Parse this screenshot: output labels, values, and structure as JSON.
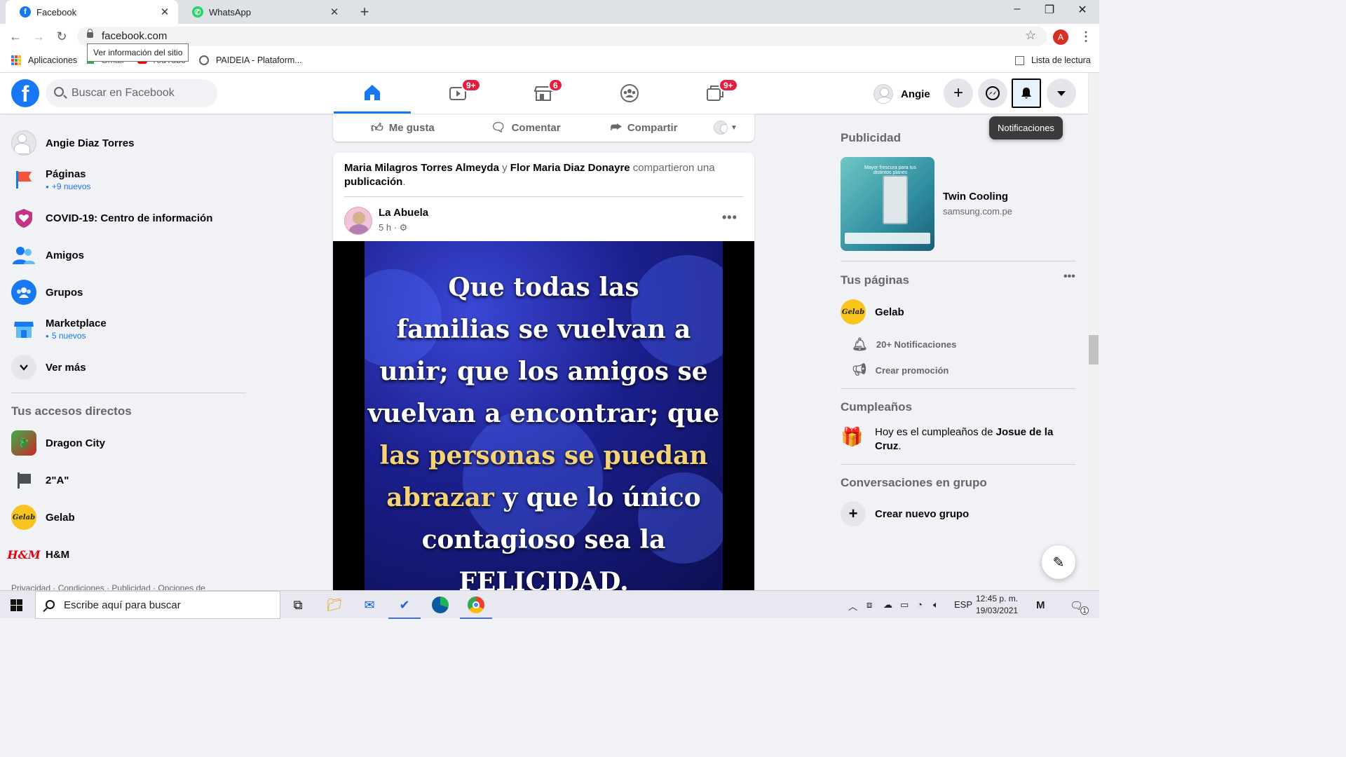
{
  "browser": {
    "tabs": [
      {
        "title": "Facebook",
        "active": true
      },
      {
        "title": "WhatsApp",
        "active": false
      }
    ],
    "new_tab": "+",
    "close_glyph": "✕",
    "url": "facebook.com",
    "site_info_tooltip": "Ver información del sitio",
    "profile_initial": "A",
    "bookmarks": {
      "apps": "Aplicaciones",
      "gmail": "Gmail",
      "youtube": "YouTube",
      "paideia": "PAIDEIA - Plataform...",
      "reading_list": "Lista de lectura"
    }
  },
  "fb": {
    "search_placeholder": "Buscar en Facebook",
    "nav_badges": {
      "watch": "9+",
      "marketplace": "6",
      "gaming": "9+"
    },
    "user_name": "Angie",
    "notifications_tooltip": "Notificaciones"
  },
  "left": {
    "items": [
      {
        "label": "Angie Diaz Torres"
      },
      {
        "label": "Páginas",
        "sub": "+9 nuevos"
      },
      {
        "label": "COVID-19: Centro de información"
      },
      {
        "label": "Amigos"
      },
      {
        "label": "Grupos"
      },
      {
        "label": "Marketplace",
        "sub": "5 nuevos"
      },
      {
        "label": "Ver más"
      }
    ],
    "shortcuts_title": "Tus accesos directos",
    "shortcuts": [
      {
        "label": "Dragon City"
      },
      {
        "label": "2\"A\""
      },
      {
        "label": "Gelab"
      },
      {
        "label": "H&M"
      }
    ],
    "footer": "Privacidad · Condiciones · Publicidad · Opciones de"
  },
  "feed": {
    "actions": {
      "like": "Me gusta",
      "comment": "Comentar",
      "share": "Compartir"
    },
    "post": {
      "sharer1": "Maria Milagros Torres Almeyda",
      "conj": " y ",
      "sharer2": "Flor Maria Diaz Donayre",
      "shared_text": " compartieron una ",
      "shared_obj": "publicación",
      "period": ".",
      "page_name": "La Abuela",
      "time": "5 h ·",
      "image_text": {
        "line1": "Que todas las",
        "line2": "familias se vuelvan a",
        "line3": "unir; que los amigos se",
        "line4": "vuelvan a encontrar; que",
        "line5": "las personas se puedan",
        "line6a": "abrazar",
        "line6b": " y que lo único",
        "line7": "contagioso sea la",
        "line8": "FELICIDAD."
      }
    }
  },
  "right": {
    "ads_title": "Publicidad",
    "ad": {
      "title": "Twin Cooling",
      "domain": "samsung.com.pe",
      "image_text": "Mayor frescura para tus distintos planes"
    },
    "pages_title": "Tus páginas",
    "page": {
      "name": "Gelab",
      "logo_text": "Gelab",
      "notifications": "20+ Notificaciones",
      "promotion": "Crear promoción"
    },
    "birthdays_title": "Cumpleaños",
    "birthday": {
      "prefix": "Hoy es el cumpleaños de ",
      "name": "Josue de la Cruz",
      "suffix": "."
    },
    "groups_title": "Conversaciones en grupo",
    "new_group": "Crear nuevo grupo"
  },
  "taskbar": {
    "search_placeholder": "Escribe aquí para buscar",
    "lang": "ESP",
    "time": "12:45 p. m.",
    "date": "19/03/2021",
    "notif_count": "1"
  },
  "colors": {
    "fb_blue": "#1877f2",
    "badge_red": "#e41e3f"
  }
}
